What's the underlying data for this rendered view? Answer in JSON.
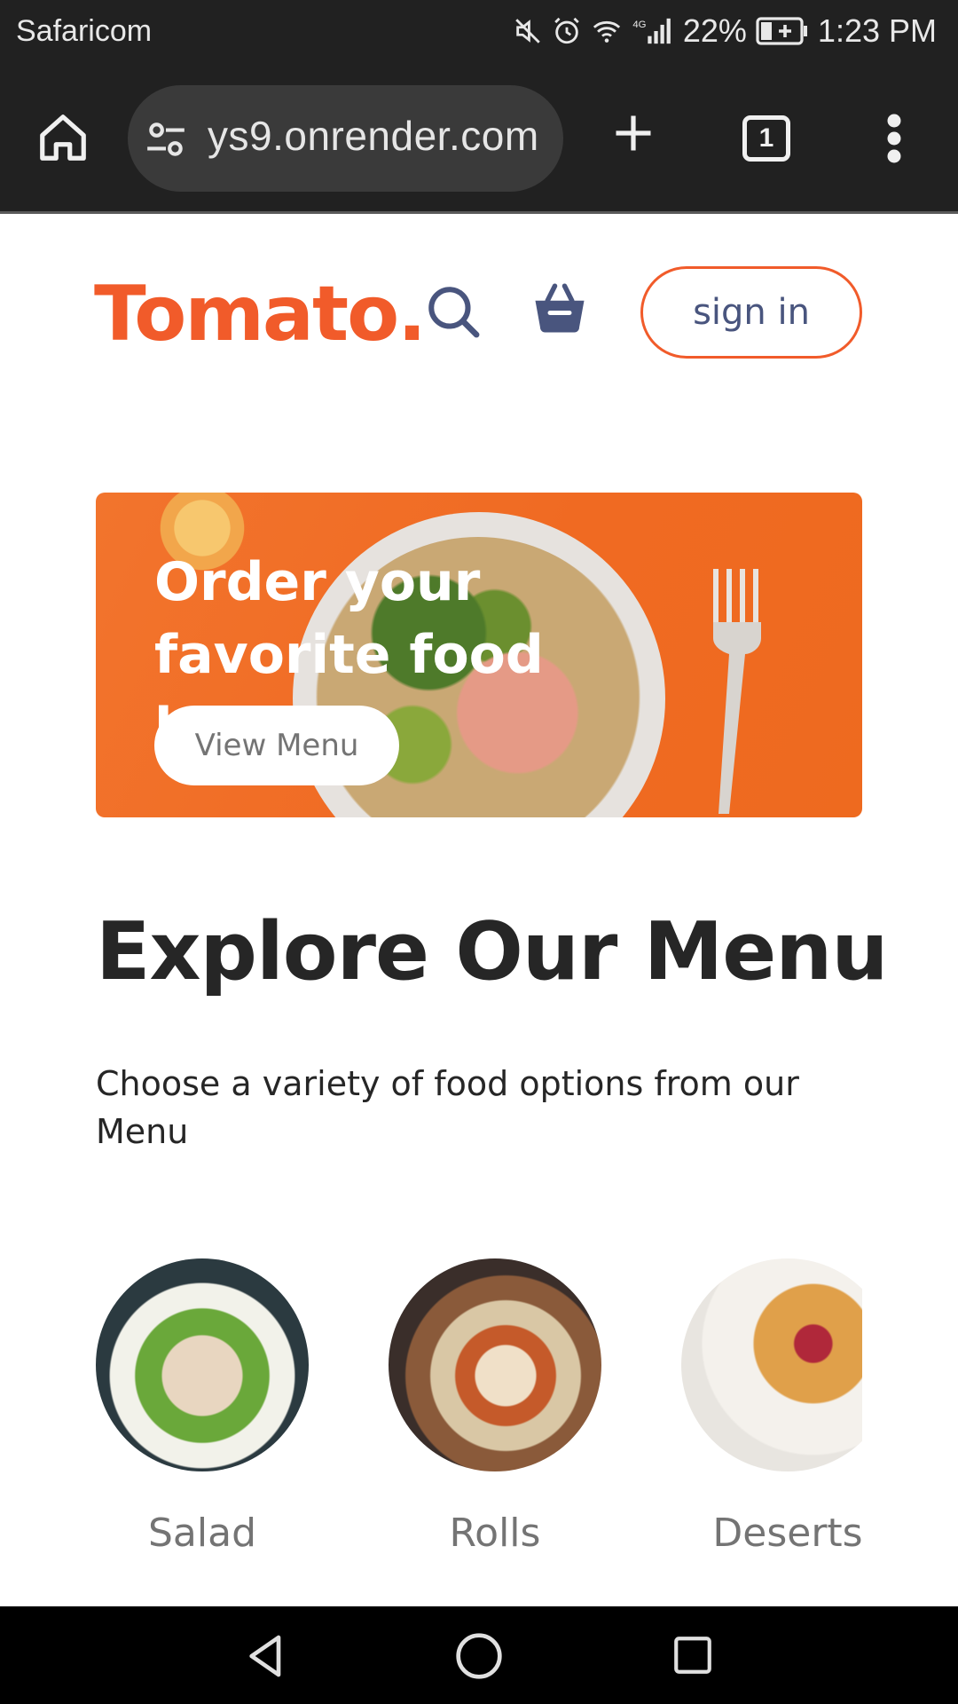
{
  "status_bar": {
    "carrier": "Safaricom",
    "network": "4G",
    "battery": "22%",
    "time": "1:23 PM"
  },
  "browser": {
    "url": "ys9.onrender.com",
    "tab_count": "1"
  },
  "navbar": {
    "logo": "Tomato.",
    "signin_label": "sign in"
  },
  "hero": {
    "title": "Order your favorite food here",
    "button_label": "View Menu"
  },
  "explore": {
    "title": "Explore Our Menu",
    "description": "Choose a variety of food options from our Menu"
  },
  "categories": [
    {
      "label": "Salad"
    },
    {
      "label": "Rolls"
    },
    {
      "label": "Deserts"
    }
  ],
  "colors": {
    "brand": "#f15b2a",
    "hero_bg": "#f06a22",
    "text_dark": "#262626",
    "text_muted": "#747474",
    "signin_text": "#49557e"
  }
}
